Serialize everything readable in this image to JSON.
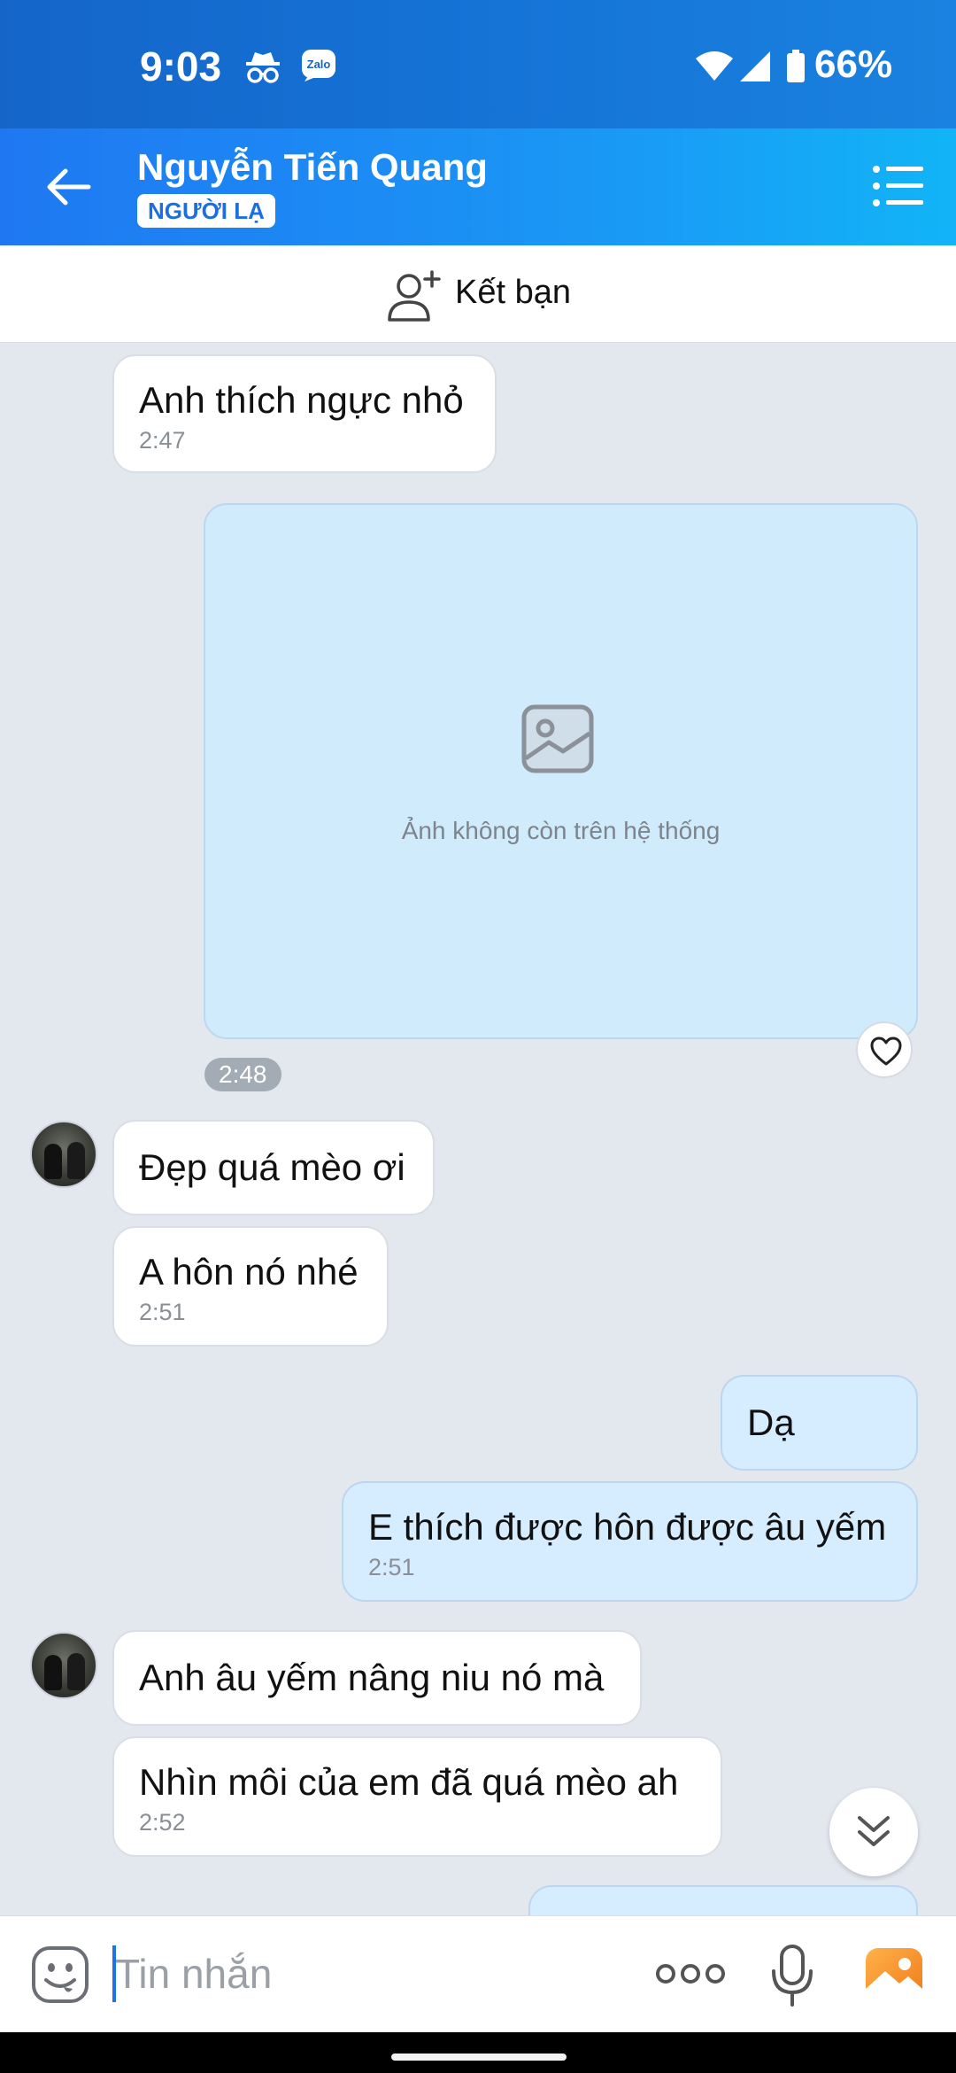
{
  "status_bar": {
    "time": "9:03",
    "battery": "66%",
    "icons": [
      "incognito-icon",
      "zalo-notification-icon",
      "wifi-icon",
      "signal-icon",
      "battery-icon"
    ]
  },
  "header": {
    "name": "Nguyễn Tiến Quang",
    "badge": "NGƯỜI LẠ"
  },
  "add_friend": {
    "label": "Kết bạn"
  },
  "messages": [
    {
      "from": "them",
      "text": "Anh thích ngực nhỏ",
      "time": "2:47"
    },
    {
      "from": "me",
      "type": "image",
      "text": "Ảnh không còn trên hệ thống",
      "time": "2:48"
    },
    {
      "from": "them",
      "text": "Đẹp quá mèo ơi"
    },
    {
      "from": "them",
      "text": "A hôn nó nhé",
      "time": "2:51"
    },
    {
      "from": "me",
      "text": "Dạ"
    },
    {
      "from": "me",
      "text": "E thích được hôn được âu yếm",
      "time": "2:51"
    },
    {
      "from": "them",
      "text": "Anh âu yếm nâng niu nó mà"
    },
    {
      "from": "them",
      "text": "Nhìn môi của em đã quá mèo ah",
      "time": "2:52"
    }
  ],
  "input": {
    "placeholder": "Tin nhắn"
  },
  "colors": {
    "header_start": "#1f78f2",
    "header_end": "#12b4f7",
    "my_bubble": "#d6ecff",
    "their_bubble": "#ffffff",
    "chat_bg": "#e3e8ef",
    "accent": "#1a73e8"
  }
}
